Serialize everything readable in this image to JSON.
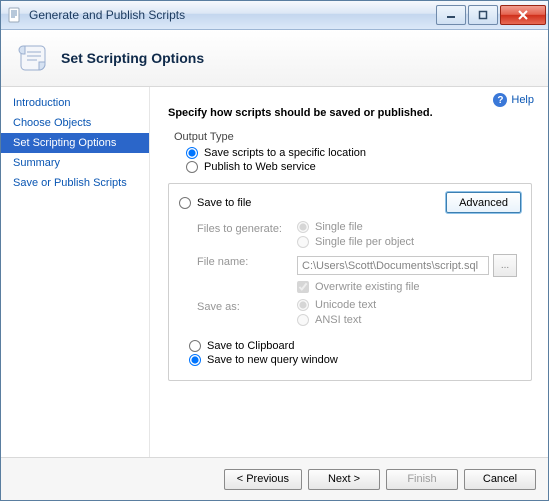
{
  "window": {
    "title": "Generate and Publish Scripts"
  },
  "header": {
    "title": "Set Scripting Options"
  },
  "help": {
    "label": "Help"
  },
  "sidebar": {
    "items": [
      {
        "label": "Introduction"
      },
      {
        "label": "Choose Objects"
      },
      {
        "label": "Set Scripting Options"
      },
      {
        "label": "Summary"
      },
      {
        "label": "Save or Publish Scripts"
      }
    ],
    "selectedIndex": 2
  },
  "main": {
    "instruction": "Specify how scripts should be saved or published.",
    "outputType": {
      "label": "Output Type",
      "save": "Save scripts to a specific location",
      "publish": "Publish to Web service"
    },
    "group": {
      "saveToFile": "Save to file",
      "advanced": "Advanced",
      "filesToGenerate": {
        "label": "Files to generate:",
        "single": "Single file",
        "perObject": "Single file per object"
      },
      "fileName": {
        "label": "File name:",
        "value": "C:\\Users\\Scott\\Documents\\script.sql",
        "browse": "...",
        "overwrite": "Overwrite existing file"
      },
      "saveAs": {
        "label": "Save as:",
        "unicode": "Unicode text",
        "ansi": "ANSI text"
      },
      "saveToClipboard": "Save to Clipboard",
      "saveToNewQuery": "Save to new query window"
    }
  },
  "footer": {
    "previous": "< Previous",
    "next": "Next >",
    "finish": "Finish",
    "cancel": "Cancel"
  }
}
